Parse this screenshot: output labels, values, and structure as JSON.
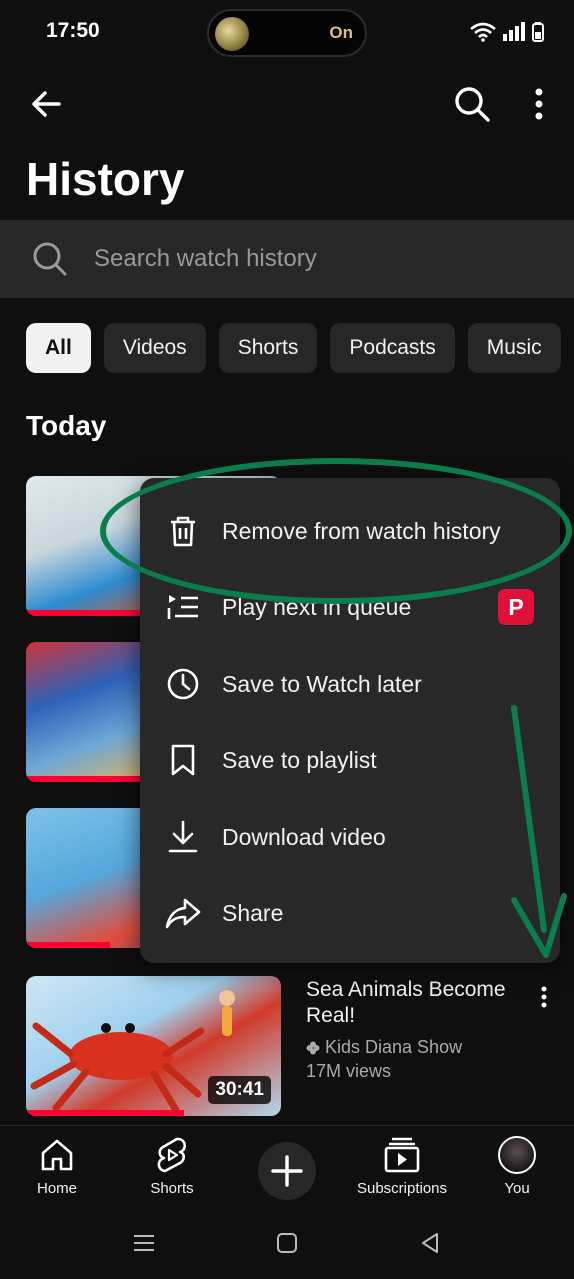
{
  "status_bar": {
    "time": "17:50",
    "island_label": "On"
  },
  "header": {
    "title": "History"
  },
  "search": {
    "placeholder": "Search watch history"
  },
  "chips": [
    "All",
    "Videos",
    "Shorts",
    "Podcasts",
    "Music"
  ],
  "active_chip": "All",
  "section": {
    "title": "Today"
  },
  "videos": [
    {
      "title": "Sea Animals Become Real!",
      "channel": "Kids Diana Show",
      "views": "17M views",
      "duration": "30:41",
      "progress": 0.62
    }
  ],
  "thumbnail_progress": [
    0.55,
    0.45,
    0.33
  ],
  "context_menu": {
    "items": [
      {
        "label": "Remove from watch history",
        "icon": "trash-icon"
      },
      {
        "label": "Play next in queue",
        "icon": "queue-icon",
        "badge": "P"
      },
      {
        "label": "Save to Watch later",
        "icon": "clock-icon"
      },
      {
        "label": "Save to playlist",
        "icon": "bookmark-icon"
      },
      {
        "label": "Download video",
        "icon": "download-icon"
      },
      {
        "label": "Share",
        "icon": "share-icon"
      }
    ]
  },
  "bottom_nav": {
    "items": [
      {
        "label": "Home",
        "icon": "home-icon"
      },
      {
        "label": "Shorts",
        "icon": "shorts-icon"
      },
      {
        "label": "Subscriptions",
        "icon": "subscriptions-icon"
      },
      {
        "label": "You",
        "icon": "avatar"
      }
    ]
  },
  "colors": {
    "background": "#0f0f0f",
    "surface": "#272727",
    "menu": "#282828",
    "accent_red": "#ff0033",
    "annotation_green": "#0b7d4c"
  }
}
